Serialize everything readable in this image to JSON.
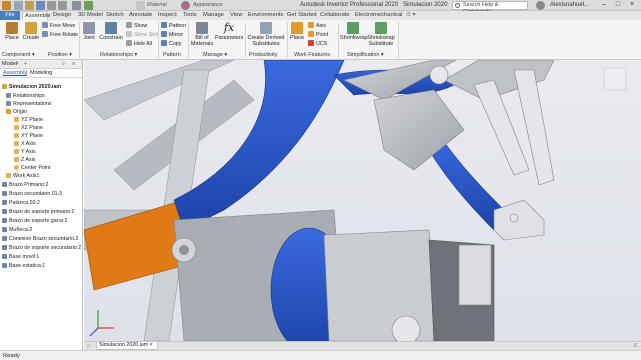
{
  "app": {
    "title": "Autodesk Inventor Professional 2020",
    "document": "Simulacion 2020",
    "search_placeholder": "Search Help & Commands...",
    "user": "Alexisnahuel...",
    "material": "Material",
    "appearance": "Appearance"
  },
  "tabs": [
    "File",
    "Assemble",
    "Design",
    "3D Model",
    "Sketch",
    "Annotate",
    "Inspect",
    "Tools",
    "Manage",
    "View",
    "Environments",
    "Get Started",
    "Collaborate",
    "Electromechanical"
  ],
  "ribbon": {
    "place": "Place",
    "create": "Create",
    "free_move": "Free Move",
    "free_rotate": "Free Rotate",
    "joint": "Joint",
    "constrain": "Constrain",
    "show": "Show",
    "show_sick": "Show Sick",
    "hide_all": "Hide All",
    "pattern": "Pattern",
    "mirror": "Mirror",
    "copy": "Copy",
    "bom1": "Bill of",
    "bom2": "Materials",
    "parameters": "Parameters",
    "cds1": "Create Derived",
    "cds2": "Substitutes",
    "plane": "Plane",
    "axis": "Axis",
    "point": "Point",
    "ucs": "UCS",
    "shrinkwrap": "Shrinkwrap",
    "sws1": "Shrinkwrap",
    "sws2": "Substitute",
    "panels": [
      "Component ▾",
      "Position ▾",
      "Relationships ▾",
      "Pattern",
      "Manage ▾",
      "Productivity",
      "Work Features",
      "Simplification ▾"
    ]
  },
  "browser": {
    "header": "Model",
    "tabs": [
      "Assembly",
      "Modeling"
    ],
    "items": [
      "Simulacion 2020.iam",
      "Relationships",
      "Representations",
      "Origin",
      "YZ Plane",
      "XZ Plane",
      "XY Plane",
      "X Axis",
      "Y Axis",
      "Z Axis",
      "Center Point",
      "Work Axis1",
      "Brazo Primario:2",
      "Brazo secundario 01:3",
      "Palanca 03:2",
      "Brazo de soporte primario:2",
      "Brazo de soporte garra:2",
      "Muñeca:2",
      "Conexion Brazo secundario:2",
      "Brazo de soporte secundario:2",
      "Base movil:1",
      "Base estatica:1"
    ]
  },
  "doc_tab": "Simulacion 2020.iam",
  "status": "Ready",
  "colors": {
    "accent": "#4a7ec0",
    "part_blue": "#2453c9",
    "part_orange": "#e07a16",
    "part_gray": "#b9bcc2"
  }
}
